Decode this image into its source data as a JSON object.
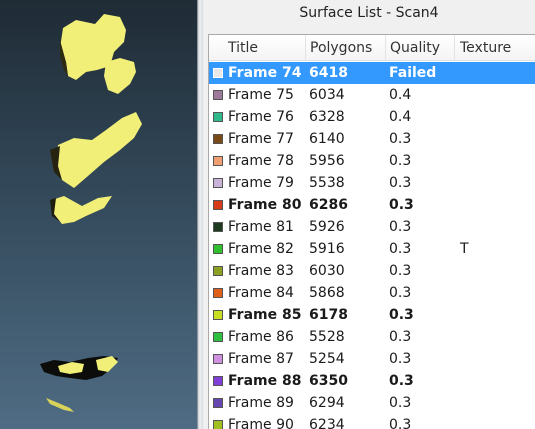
{
  "panel": {
    "title": "Surface List - Scan4"
  },
  "columns": {
    "title": "Title",
    "polygons": "Polygons",
    "quality": "Quality",
    "texture": "Texture"
  },
  "rows": [
    {
      "title": "Frame 74",
      "polygons": "6418",
      "quality": "Failed",
      "texture": "",
      "swatch": "#e8e8e8",
      "selected": true,
      "bold": true
    },
    {
      "title": "Frame 75",
      "polygons": "6034",
      "quality": "0.4",
      "texture": "",
      "swatch": "#9d7a9a",
      "selected": false,
      "bold": false
    },
    {
      "title": "Frame 76",
      "polygons": "6328",
      "quality": "0.4",
      "texture": "",
      "swatch": "#2fb98a",
      "selected": false,
      "bold": false
    },
    {
      "title": "Frame 77",
      "polygons": "6140",
      "quality": "0.3",
      "texture": "",
      "swatch": "#7a4a16",
      "selected": false,
      "bold": false
    },
    {
      "title": "Frame 78",
      "polygons": "5956",
      "quality": "0.3",
      "texture": "",
      "swatch": "#f0a070",
      "selected": false,
      "bold": false
    },
    {
      "title": "Frame 79",
      "polygons": "5538",
      "quality": "0.3",
      "texture": "",
      "swatch": "#c9b3d8",
      "selected": false,
      "bold": false
    },
    {
      "title": "Frame 80",
      "polygons": "6286",
      "quality": "0.3",
      "texture": "",
      "swatch": "#d83a1a",
      "selected": false,
      "bold": true
    },
    {
      "title": "Frame 81",
      "polygons": "5926",
      "quality": "0.3",
      "texture": "",
      "swatch": "#1e3a1e",
      "selected": false,
      "bold": false
    },
    {
      "title": "Frame 82",
      "polygons": "5916",
      "quality": "0.3",
      "texture": "T",
      "swatch": "#2fbf2f",
      "selected": false,
      "bold": false
    },
    {
      "title": "Frame 83",
      "polygons": "6030",
      "quality": "0.3",
      "texture": "",
      "swatch": "#8aa020",
      "selected": false,
      "bold": false
    },
    {
      "title": "Frame 84",
      "polygons": "5868",
      "quality": "0.3",
      "texture": "",
      "swatch": "#e0601a",
      "selected": false,
      "bold": false
    },
    {
      "title": "Frame 85",
      "polygons": "6178",
      "quality": "0.3",
      "texture": "",
      "swatch": "#c8e020",
      "selected": false,
      "bold": true
    },
    {
      "title": "Frame 86",
      "polygons": "5528",
      "quality": "0.3",
      "texture": "",
      "swatch": "#30c040",
      "selected": false,
      "bold": false
    },
    {
      "title": "Frame 87",
      "polygons": "5254",
      "quality": "0.3",
      "texture": "",
      "swatch": "#d090e0",
      "selected": false,
      "bold": false
    },
    {
      "title": "Frame 88",
      "polygons": "6350",
      "quality": "0.3",
      "texture": "",
      "swatch": "#8040d8",
      "selected": false,
      "bold": true
    },
    {
      "title": "Frame 89",
      "polygons": "6294",
      "quality": "0.3",
      "texture": "",
      "swatch": "#6848b0",
      "selected": false,
      "bold": false
    },
    {
      "title": "Frame 90",
      "polygons": "6234",
      "quality": "0.3",
      "texture": "",
      "swatch": "#a0c020",
      "selected": false,
      "bold": false
    }
  ],
  "colors": {
    "selection": "#3399ff",
    "surface": "#f2ef78"
  }
}
